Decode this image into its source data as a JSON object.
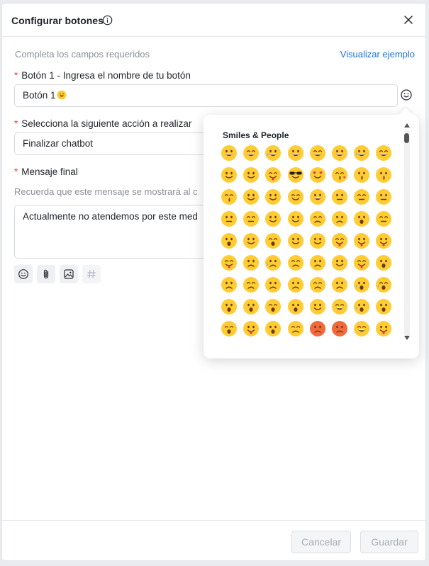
{
  "header": {
    "title": "Configurar botones"
  },
  "form": {
    "hint": "Completa los campos requeridos",
    "example_link": "Visualizar ejemplo",
    "button1_label": "Botón 1 - Ingresa el nombre de tu botón",
    "button1_value": "Botón 1",
    "action_label": "Selecciona la siguiente acción a realizar",
    "action_value": "Finalizar chatbot",
    "message_label": "Mensaje final",
    "message_hint": "Recuerda que este mensaje se mostrará al c",
    "message_value": "Actualmente no atendemos por este med"
  },
  "emoji_picker": {
    "category": "Smiles & People",
    "emojis": [
      "grinning",
      "beaming",
      "joy-tears",
      "rofl",
      "smiley",
      "grin-eyes",
      "sweat-smile",
      "squint",
      "wink",
      "blush",
      "yum",
      "sunglasses",
      "heart-eyes",
      "kiss-heart",
      "kissing",
      "kissing-smile",
      "kiss-closed",
      "relaxed",
      "slight-smile",
      "hug",
      "star-struck",
      "thinking",
      "raised-brow",
      "neutral",
      "expressionless",
      "no-mouth",
      "eye-roll",
      "smirk",
      "persevere",
      "sad-relieved",
      "open-mouth",
      "zipper",
      "hushed",
      "sleepy",
      "tired",
      "sleeping",
      "relieved",
      "tongue",
      "tongue-wink",
      "tongue-squint",
      "drool",
      "unamused",
      "sweat",
      "pensive",
      "confused",
      "upside-down",
      "money",
      "astonished",
      "frowning",
      "slight-frown",
      "confounded",
      "disappointed",
      "worried",
      "steam",
      "crying",
      "sob",
      "frown-open",
      "anguished",
      "fearful",
      "weary",
      "exploding",
      "grimace",
      "cold-sweat",
      "scream",
      "flushed",
      "zany",
      "dizzy",
      "pouting",
      "angry",
      "cursing",
      "mask",
      "thermometer"
    ]
  },
  "footer": {
    "cancel": "Cancelar",
    "save": "Guardar"
  },
  "colors": {
    "accent": "#1a73d9",
    "required": "#e04848",
    "emoji_face": "#ffcc33"
  }
}
